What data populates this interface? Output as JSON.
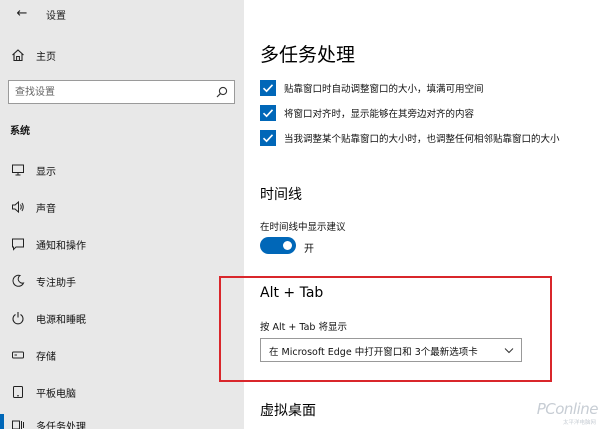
{
  "window": {
    "back_glyph": "←",
    "title": "设置"
  },
  "sidebar": {
    "home_label": "主页",
    "search_placeholder": "查找设置",
    "section_header": "系统",
    "items": [
      {
        "label": "显示",
        "icon": "monitor-icon"
      },
      {
        "label": "声音",
        "icon": "speaker-icon"
      },
      {
        "label": "通知和操作",
        "icon": "notification-icon"
      },
      {
        "label": "专注助手",
        "icon": "moon-icon"
      },
      {
        "label": "电源和睡眠",
        "icon": "power-icon"
      },
      {
        "label": "存储",
        "icon": "storage-icon"
      },
      {
        "label": "平板电脑",
        "icon": "tablet-icon"
      },
      {
        "label": "多任务处理",
        "icon": "multitask-icon",
        "active": true
      }
    ]
  },
  "main": {
    "title": "多任务处理",
    "snap_options": [
      {
        "label": "贴靠窗口时自动调整窗口的大小，填满可用空间",
        "checked": true
      },
      {
        "label": "将窗口对齐时，显示能够在其旁边对齐的内容",
        "checked": true
      },
      {
        "label": "当我调整某个贴靠窗口的大小时，也调整任何相邻贴靠窗口的大小",
        "checked": true
      }
    ],
    "timeline": {
      "heading": "时间线",
      "suggestion_label": "在时间线中显示建议",
      "toggle_state": "开",
      "toggle_on": true
    },
    "alttab": {
      "heading": "Alt + Tab",
      "label": "按 Alt + Tab 将显示",
      "selected": "在 Microsoft Edge 中打开窗口和 3个最新选项卡"
    },
    "virtual_desktops": {
      "heading": "虚拟桌面"
    }
  },
  "watermark": {
    "text": "PConline",
    "subtext": "太平洋电脑网"
  },
  "colors": {
    "accent": "#0067b8",
    "highlight": "#d9262b",
    "sidebar_bg": "#e8e8e8"
  }
}
